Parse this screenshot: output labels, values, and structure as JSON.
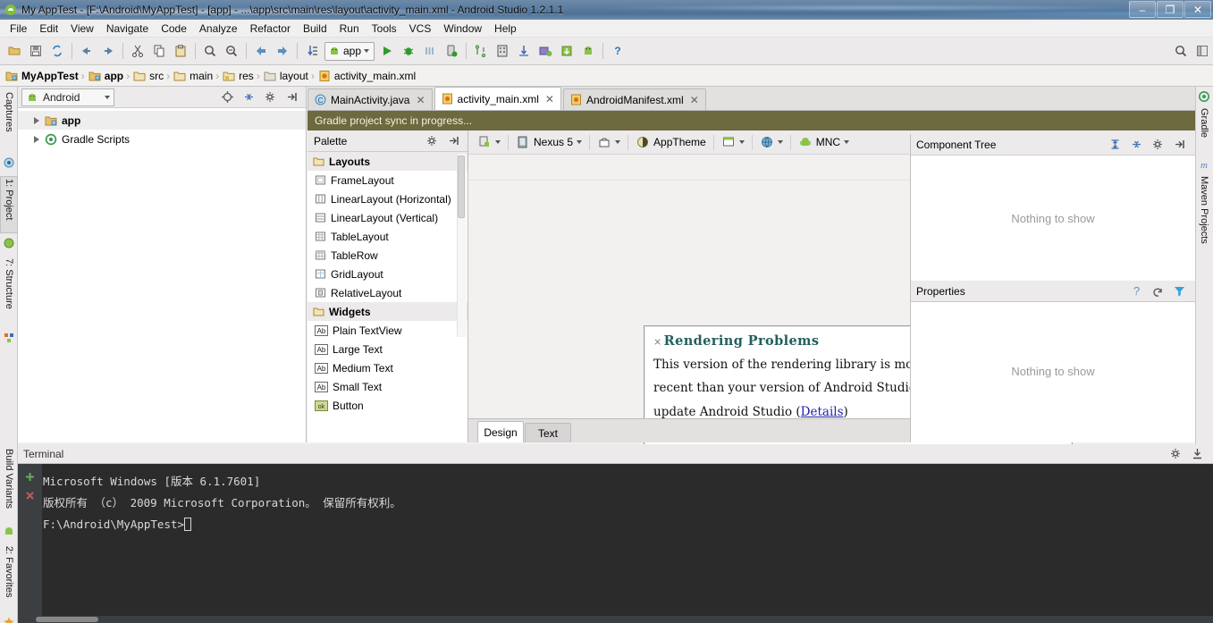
{
  "window": {
    "title": "My AppTest - [F:\\Android\\MyAppTest] - [app] - ...\\app\\src\\main\\res\\layout\\activity_main.xml - Android Studio 1.2.1.1",
    "icon": "android-studio-icon",
    "minimize_label": "–",
    "maximize_label": "❐",
    "close_label": "✕"
  },
  "menubar": {
    "items": [
      {
        "label": "File"
      },
      {
        "label": "Edit"
      },
      {
        "label": "View"
      },
      {
        "label": "Navigate"
      },
      {
        "label": "Code"
      },
      {
        "label": "Analyze"
      },
      {
        "label": "Refactor"
      },
      {
        "label": "Build"
      },
      {
        "label": "Run"
      },
      {
        "label": "Tools"
      },
      {
        "label": "VCS"
      },
      {
        "label": "Window"
      },
      {
        "label": "Help"
      }
    ]
  },
  "toolbar": {
    "run_config_label": "app",
    "icons": [
      "open-project-icon",
      "save-all-icon",
      "sync-icon",
      "undo-icon",
      "redo-icon",
      "cut-icon",
      "copy-icon",
      "paste-icon",
      "find-icon",
      "replace-icon",
      "back-icon",
      "forward-icon",
      "compile-icon"
    ],
    "right_icons": [
      "help-icon",
      "search-everywhere-icon",
      "layout-icon"
    ]
  },
  "breadcrumb": {
    "items": [
      {
        "label": "MyAppTest",
        "icon": "module-folder-icon",
        "bold": true
      },
      {
        "label": "app",
        "icon": "module-folder-icon",
        "bold": true
      },
      {
        "label": "src",
        "icon": "folder-icon",
        "bold": false
      },
      {
        "label": "main",
        "icon": "folder-icon",
        "bold": false
      },
      {
        "label": "res",
        "icon": "res-folder-icon",
        "bold": false
      },
      {
        "label": "layout",
        "icon": "folder-icon",
        "bold": false
      },
      {
        "label": "activity_main.xml",
        "icon": "xml-file-icon",
        "bold": false
      }
    ]
  },
  "left_rail": {
    "tabs": [
      {
        "label": "Captures",
        "icon": "captures-icon",
        "selected": false
      },
      {
        "label": "1: Project",
        "icon": "project-icon",
        "selected": true
      },
      {
        "label": "7: Structure",
        "icon": "structure-icon",
        "selected": false
      }
    ],
    "bottom_tabs": [
      {
        "label": "Build Variants",
        "icon": "android-icon"
      },
      {
        "label": "2: Favorites",
        "icon": "star-icon"
      }
    ]
  },
  "right_rail": {
    "tabs": [
      {
        "label": "Gradle",
        "icon": "gradle-icon"
      },
      {
        "label": "Maven Projects",
        "icon": "maven-icon"
      }
    ]
  },
  "project_panel": {
    "view_selector": "Android",
    "header_icons": [
      "target-icon",
      "collapse-all-icon",
      "gear-icon",
      "hide-icon"
    ],
    "tree": [
      {
        "label": "app",
        "icon": "module-folder-icon",
        "bold": true,
        "selected": true
      },
      {
        "label": "Gradle Scripts",
        "icon": "gradle-icon",
        "bold": false,
        "selected": false
      }
    ]
  },
  "editor": {
    "tabs": [
      {
        "label": "MainActivity.java",
        "icon": "java-class-icon",
        "active": false,
        "close": "✕"
      },
      {
        "label": "activity_main.xml",
        "icon": "xml-file-icon",
        "active": true,
        "close": "✕"
      },
      {
        "label": "AndroidManifest.xml",
        "icon": "xml-file-icon",
        "active": false,
        "close": "✕"
      }
    ],
    "sync_message": "Gradle project sync in progress...",
    "bottom_tabs": [
      {
        "label": "Design",
        "active": true
      },
      {
        "label": "Text",
        "active": false
      }
    ]
  },
  "palette": {
    "title": "Palette",
    "header_icons": [
      "gear-icon",
      "hide-icon"
    ],
    "groups": [
      {
        "label": "Layouts",
        "icon": "folder-icon",
        "items": [
          {
            "label": "FrameLayout",
            "icon": "frame-layout-icon"
          },
          {
            "label": "LinearLayout (Horizontal)",
            "icon": "linear-layout-h-icon"
          },
          {
            "label": "LinearLayout (Vertical)",
            "icon": "linear-layout-v-icon"
          },
          {
            "label": "TableLayout",
            "icon": "table-layout-icon"
          },
          {
            "label": "TableRow",
            "icon": "table-row-icon"
          },
          {
            "label": "GridLayout",
            "icon": "grid-layout-icon"
          },
          {
            "label": "RelativeLayout",
            "icon": "relative-layout-icon"
          }
        ]
      },
      {
        "label": "Widgets",
        "icon": "folder-icon",
        "items": [
          {
            "label": "Plain TextView",
            "icon": "ab-icon"
          },
          {
            "label": "Large Text",
            "icon": "ab-icon"
          },
          {
            "label": "Medium Text",
            "icon": "ab-icon"
          },
          {
            "label": "Small Text",
            "icon": "ab-icon"
          },
          {
            "label": "Button",
            "icon": "ok-button-icon"
          }
        ]
      }
    ]
  },
  "canvas_toolbar": {
    "device_config_icon": "device-config-icon",
    "device": "Nexus 5",
    "orientation_icon": "orientation-icon",
    "theme": "AppTheme",
    "activity_icon": "activity-icon",
    "locale_icon": "globe-icon",
    "api_level": "MNC",
    "zoom_buttons": [
      "zoom-fit-icon",
      "zoom-actual-icon",
      "zoom-in-icon",
      "zoom-out-icon",
      "screenshot-icon",
      "refresh-icon",
      "gear-icon"
    ]
  },
  "render_problems": {
    "close_mark": "×",
    "title": "Rendering Problems",
    "line1": "This version of the rendering library is more",
    "line2": "recent than your version of Android Studio. Please",
    "line3_prefix": "update Android Studio (",
    "link": "Details",
    "line3_suffix": ")"
  },
  "component_tree": {
    "title": "Component Tree",
    "empty_text": "Nothing to show",
    "header_icons": [
      "expand-all-icon",
      "collapse-all-icon",
      "gear-icon",
      "hide-icon"
    ]
  },
  "properties": {
    "title": "Properties",
    "empty_text": "Nothing to show",
    "header_icons": [
      "help-icon",
      "restore-icon",
      "filter-icon"
    ]
  },
  "terminal": {
    "title": "Terminal",
    "header_icons": [
      "gear-icon",
      "hide-icon"
    ],
    "gutter_icons": [
      "new-session-plus-icon",
      "close-session-x-icon"
    ],
    "lines": [
      "Microsoft Windows [版本 6.1.7601]",
      "版权所有 （c） 2009 Microsoft Corporation。 保留所有权利。",
      "",
      "F:\\Android\\MyAppTest>"
    ]
  },
  "colors": {
    "titlebar": "#5d7fa3",
    "sync_bar": "#6c6a3e",
    "render_title": "#22605f",
    "link": "#2020b0",
    "terminal_bg": "#2b2b2b",
    "panel_bg": "#eceaea",
    "accent_green": "#2e9b2e"
  }
}
